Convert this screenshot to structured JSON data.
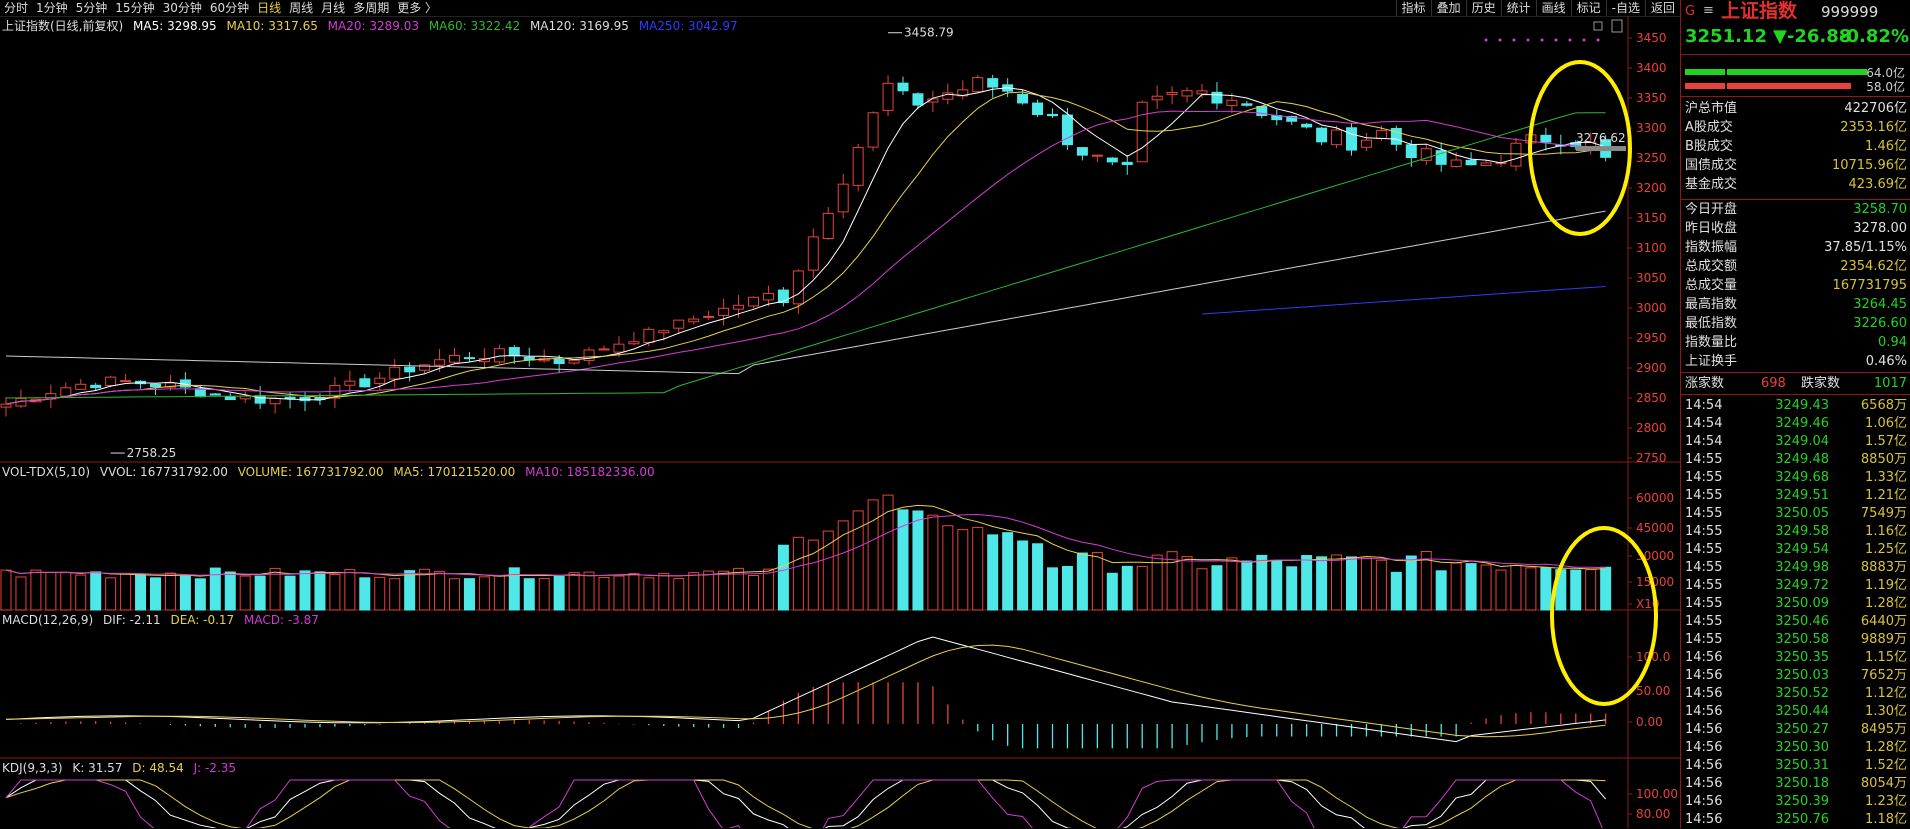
{
  "toolbar": {
    "periods": [
      "分时",
      "1分钟",
      "5分钟",
      "15分钟",
      "30分钟",
      "60分钟",
      "日线",
      "周线",
      "月线",
      "多周期",
      "更多 〉"
    ],
    "active_period": "日线",
    "tools": [
      "指标",
      "叠加",
      "历史",
      "统计",
      "画线",
      "标记",
      "-自选",
      "返回"
    ]
  },
  "main_legend": {
    "title": "上证指数(日线,前复权)",
    "ma5": "MA5: 3298.95",
    "ma10": "MA10: 3317.65",
    "ma20": "MA20: 3289.03",
    "ma60": "MA60: 3322.42",
    "ma120": "MA120: 3169.95",
    "ma250": "MA250: 3042.97"
  },
  "price_axis": [
    "3450",
    "3400",
    "3350",
    "3300",
    "3250",
    "3200",
    "3150",
    "3100",
    "3050",
    "3000",
    "2950",
    "2900",
    "2850",
    "2800",
    "2750"
  ],
  "annotations": {
    "high": "3458.79",
    "low": "2758.25",
    "current": "3276.62"
  },
  "vol_legend": {
    "title": "VOL-TDX(5,10)",
    "vvol": "VVOL: 167731792.00",
    "volume": "VOLUME: 167731792.00",
    "ma5": "MA5: 170121520.00",
    "ma10": "MA10: 185182336.00"
  },
  "vol_axis": [
    "60000",
    "45000",
    "30000",
    "15000",
    "X10"
  ],
  "macd_legend": {
    "title": "MACD(12,26,9)",
    "dif": "DIF: -2.11",
    "dea": "DEA: -0.17",
    "macd": "MACD: -3.87"
  },
  "macd_axis": [
    "100.0",
    "50.00",
    "0.00"
  ],
  "kdj_legend": {
    "title": "KDJ(9,3,3)",
    "k": "K: 31.57",
    "d": "D: 48.54",
    "j": "J: -2.35"
  },
  "kdj_axis": [
    "100.00",
    "80.00"
  ],
  "quote": {
    "g_mark": "G",
    "list_mark": "≡",
    "name": "上证指数",
    "code": "999999",
    "price": "3251.12",
    "change": "▼-26.88",
    "pct": "-0.82%",
    "bar1_value": "64.0亿",
    "bar2_value": "58.0亿",
    "stats_a": [
      {
        "k": "沪总市值",
        "v": "422706亿",
        "c": "#e0e0e0"
      },
      {
        "k": "A股成交",
        "v": "2353.16亿",
        "c": "#d8c23a"
      },
      {
        "k": "B股成交",
        "v": "1.46亿",
        "c": "#d8c23a"
      },
      {
        "k": "国债成交",
        "v": "10715.96亿",
        "c": "#d8c23a"
      },
      {
        "k": "基金成交",
        "v": "423.69亿",
        "c": "#d8c23a"
      }
    ],
    "stats_b": [
      {
        "k": "今日开盘",
        "v": "3258.70",
        "c": "#21d421"
      },
      {
        "k": "昨日收盘",
        "v": "3278.00",
        "c": "#e0e0e0"
      },
      {
        "k": "指数振幅",
        "v": "37.85/1.15%",
        "c": "#e0e0e0"
      },
      {
        "k": "总成交额",
        "v": "2354.62亿",
        "c": "#d8c23a"
      },
      {
        "k": "总成交量",
        "v": "167731795",
        "c": "#d8c23a"
      },
      {
        "k": "最高指数",
        "v": "3264.45",
        "c": "#21d421"
      },
      {
        "k": "最低指数",
        "v": "3226.60",
        "c": "#21d421"
      },
      {
        "k": "指数量比",
        "v": "0.94",
        "c": "#21d421"
      },
      {
        "k": "上证换手",
        "v": "0.46%",
        "c": "#e0e0e0"
      }
    ],
    "up_label": "涨家数",
    "up_count": "698",
    "down_label": "跌家数",
    "down_count": "1017",
    "ticks": [
      [
        "14:54",
        "3249.43",
        "6568万"
      ],
      [
        "14:54",
        "3249.46",
        "1.06亿"
      ],
      [
        "14:54",
        "3249.04",
        "1.57亿"
      ],
      [
        "14:55",
        "3249.48",
        "8850万"
      ],
      [
        "14:55",
        "3249.68",
        "1.33亿"
      ],
      [
        "14:55",
        "3249.51",
        "1.21亿"
      ],
      [
        "14:55",
        "3250.05",
        "7549万"
      ],
      [
        "14:55",
        "3249.58",
        "1.16亿"
      ],
      [
        "14:55",
        "3249.54",
        "1.25亿"
      ],
      [
        "14:55",
        "3249.98",
        "8883万"
      ],
      [
        "14:55",
        "3249.72",
        "1.19亿"
      ],
      [
        "14:55",
        "3250.09",
        "1.28亿"
      ],
      [
        "14:55",
        "3250.46",
        "6440万"
      ],
      [
        "14:55",
        "3250.58",
        "9889万"
      ],
      [
        "14:56",
        "3250.35",
        "1.15亿"
      ],
      [
        "14:56",
        "3250.03",
        "7652万"
      ],
      [
        "14:56",
        "3250.52",
        "1.12亿"
      ],
      [
        "14:56",
        "3250.44",
        "1.30亿"
      ],
      [
        "14:56",
        "3250.27",
        "8495万"
      ],
      [
        "14:56",
        "3250.30",
        "1.28亿"
      ],
      [
        "14:56",
        "3250.31",
        "1.52亿"
      ],
      [
        "14:56",
        "3250.18",
        "8054万"
      ],
      [
        "14:56",
        "3250.39",
        "1.23亿"
      ],
      [
        "14:56",
        "3250.76",
        "1.18亿"
      ]
    ]
  },
  "colors": {
    "up": "#e8423a",
    "down": "#4fe8e8",
    "ma5": "#ffffff",
    "ma10": "#e8d04a",
    "ma20": "#d43cd4",
    "ma60": "#2eb82e",
    "ma120": "#cccccc",
    "ma250": "#2a3cff",
    "highlight": "#ffee00"
  }
}
